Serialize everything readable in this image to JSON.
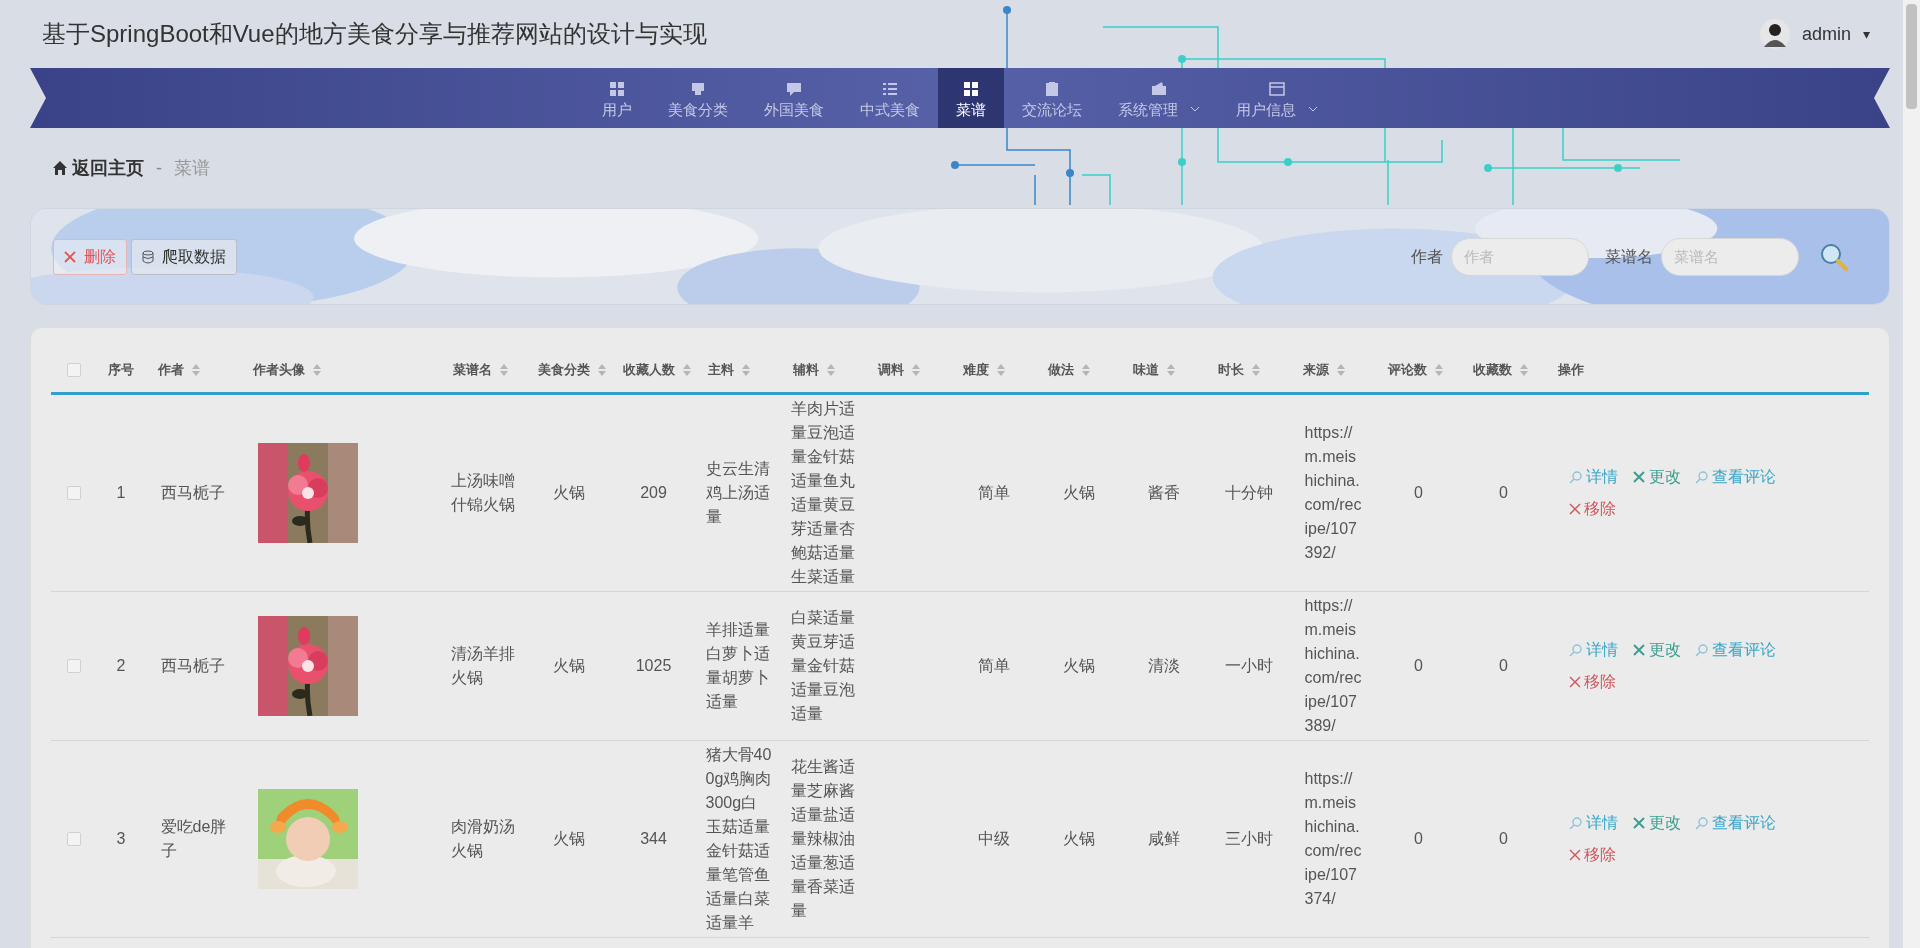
{
  "header": {
    "title": "基于SpringBoot和Vue的地方美食分享与推荐网站的设计与实现",
    "user": {
      "name": "admin",
      "caret": "▾"
    }
  },
  "nav": [
    {
      "label": "用户",
      "selected": false,
      "dropdown": false
    },
    {
      "label": "美食分类",
      "selected": false,
      "dropdown": false
    },
    {
      "label": "外国美食",
      "selected": false,
      "dropdown": false
    },
    {
      "label": "中式美食",
      "selected": false,
      "dropdown": false
    },
    {
      "label": "菜谱",
      "selected": true,
      "dropdown": false
    },
    {
      "label": "交流论坛",
      "selected": false,
      "dropdown": false
    },
    {
      "label": "系统管理",
      "selected": false,
      "dropdown": true
    },
    {
      "label": "用户信息",
      "selected": false,
      "dropdown": true
    }
  ],
  "breadcrumb": {
    "home": "返回主页",
    "separator": "-",
    "current": "菜谱"
  },
  "toolbar": {
    "buttons": [
      {
        "label": "删除",
        "kind": "delete"
      },
      {
        "label": "爬取数据",
        "kind": "crawl"
      }
    ],
    "filters": [
      {
        "label": "作者",
        "placeholder": "作者"
      },
      {
        "label": "菜谱名",
        "placeholder": "菜谱名"
      }
    ]
  },
  "table": {
    "select_all_checked": false,
    "columns": [
      {
        "label": "序号",
        "sortable": false
      },
      {
        "label": "作者",
        "sortable": true
      },
      {
        "label": "作者头像",
        "sortable": true
      },
      {
        "label": "菜谱名",
        "sortable": true
      },
      {
        "label": "美食分类",
        "sortable": true
      },
      {
        "label": "收藏人数",
        "sortable": true
      },
      {
        "label": "主料",
        "sortable": true
      },
      {
        "label": "辅料",
        "sortable": true
      },
      {
        "label": "调料",
        "sortable": true
      },
      {
        "label": "难度",
        "sortable": true
      },
      {
        "label": "做法",
        "sortable": true
      },
      {
        "label": "味道",
        "sortable": true
      },
      {
        "label": "时长",
        "sortable": true
      },
      {
        "label": "来源",
        "sortable": true
      },
      {
        "label": "评论数",
        "sortable": true
      },
      {
        "label": "收藏数",
        "sortable": true
      },
      {
        "label": "操作",
        "sortable": false
      }
    ],
    "rows": [
      {
        "checked": false,
        "no": "1",
        "author": "西马栀子",
        "name": "上汤味噌什锦火锅",
        "category": "火锅",
        "favorites": "209",
        "main": "史云生清鸡上汤适量",
        "aux": "羊肉片适量豆泡适量金针菇适量鱼丸适量黄豆芽适量杏鲍菇适量生菜适量",
        "difficulty": "简单",
        "method": "火锅",
        "taste": "酱香",
        "duration": "十分钟",
        "source": "https://m.meishichina.com/recipe/107392/",
        "comments": "0",
        "collects": "0",
        "actions": [
          {
            "label": "详情",
            "kind": "detail"
          },
          {
            "label": "更改",
            "kind": "edit"
          },
          {
            "label": "查看评论",
            "kind": "comments"
          },
          {
            "label": "移除",
            "kind": "remove"
          }
        ]
      },
      {
        "checked": false,
        "no": "2",
        "author": "西马栀子",
        "name": "清汤羊排火锅",
        "category": "火锅",
        "favorites": "1025",
        "main": "羊排适量白萝卜适量胡萝卜适量",
        "aux": "白菜适量黄豆芽适量金针菇适量豆泡适量",
        "difficulty": "简单",
        "method": "火锅",
        "taste": "清淡",
        "duration": "一小时",
        "source": "https://m.meishichina.com/recipe/107389/",
        "comments": "0",
        "collects": "0",
        "actions": [
          {
            "label": "详情",
            "kind": "detail"
          },
          {
            "label": "更改",
            "kind": "edit"
          },
          {
            "label": "查看评论",
            "kind": "comments"
          },
          {
            "label": "移除",
            "kind": "remove"
          }
        ]
      },
      {
        "checked": false,
        "no": "3",
        "author": "爱吃de胖子",
        "name": "肉滑奶汤火锅",
        "category": "火锅",
        "favorites": "344",
        "main": "猪大骨400g鸡胸肉300g白玉菇适量金针菇适量笔管鱼适量白菜适量羊",
        "aux": "花生酱适量芝麻酱适量盐适量辣椒油适量葱适量香菜适量",
        "difficulty": "中级",
        "method": "火锅",
        "taste": "咸鲜",
        "duration": "三小时",
        "source": "https://m.meishichina.com/recipe/107374/",
        "comments": "0",
        "collects": "0",
        "actions": [
          {
            "label": "详情",
            "kind": "detail"
          },
          {
            "label": "更改",
            "kind": "edit"
          },
          {
            "label": "查看评论",
            "kind": "comments"
          },
          {
            "label": "移除",
            "kind": "remove"
          }
        ]
      }
    ]
  }
}
